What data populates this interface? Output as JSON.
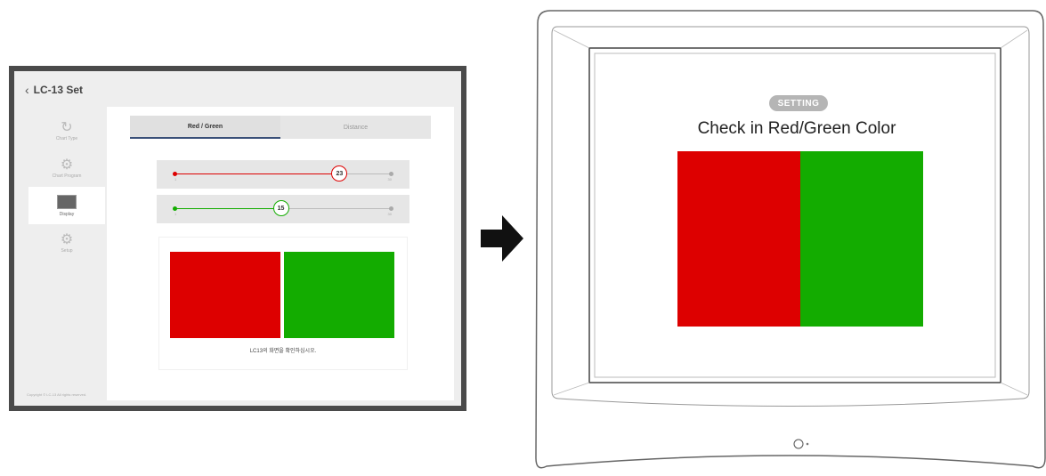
{
  "colors": {
    "red": "#dd0000",
    "green": "#13ac00",
    "nav_accent": "#3a5078"
  },
  "tablet": {
    "back_icon": "chevron-left-icon",
    "title": "LC-13 Set",
    "sidebar": [
      {
        "label": "Chart Type",
        "icon": "refresh-icon",
        "active": false
      },
      {
        "label": "Chart Program",
        "icon": "gears-icon",
        "active": false
      },
      {
        "label": "Display",
        "icon": "monitor-icon",
        "active": true
      },
      {
        "label": "Setup",
        "icon": "gear-icon",
        "active": false
      }
    ],
    "tabs": [
      {
        "label": "Red / Green",
        "active": true
      },
      {
        "label": "Distance",
        "active": false
      }
    ],
    "red_slider": {
      "value": "23",
      "min": "1",
      "max": "30",
      "level": 0.76
    },
    "green_slider": {
      "value": "15",
      "min": "1",
      "max": "30",
      "level": 0.49
    },
    "preview_caption": "LC13의 화면을 확인하십시오.",
    "copyright": "Copyright © LC-13 All rights reserved."
  },
  "monitor": {
    "badge": "SETTING",
    "title": "Check in Red/Green Color"
  }
}
